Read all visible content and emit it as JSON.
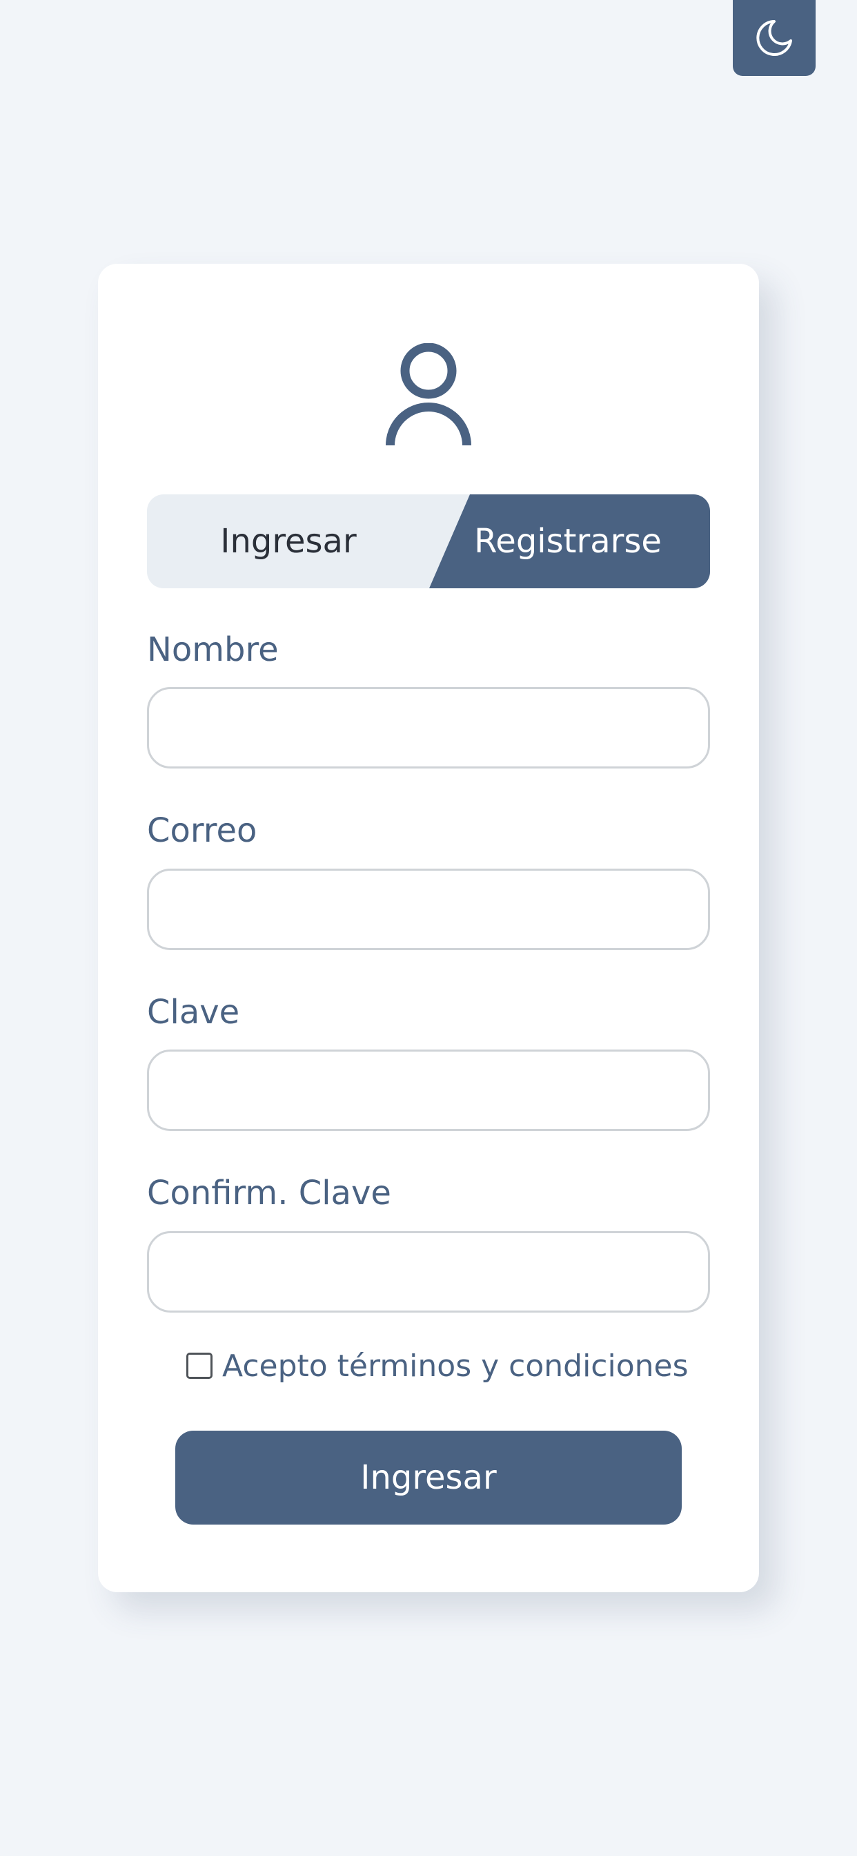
{
  "theme_toggle": {
    "icon": "moon-icon"
  },
  "card": {
    "avatar_icon": "user-icon",
    "tabs": {
      "login_label": "Ingresar",
      "register_label": "Registrarse",
      "active": "register"
    },
    "fields": {
      "name": {
        "label": "Nombre",
        "value": ""
      },
      "email": {
        "label": "Correo",
        "value": ""
      },
      "password": {
        "label": "Clave",
        "value": ""
      },
      "confirm_password": {
        "label": "Confirm. Clave",
        "value": ""
      }
    },
    "terms": {
      "label": "Acepto términos y condiciones",
      "checked": false
    },
    "submit_label": "Ingresar"
  },
  "colors": {
    "accent": "#4a6282",
    "background": "#f2f5f9",
    "card": "#ffffff",
    "tab_inactive": "#e9eef3",
    "input_border": "#cfd3d7"
  }
}
